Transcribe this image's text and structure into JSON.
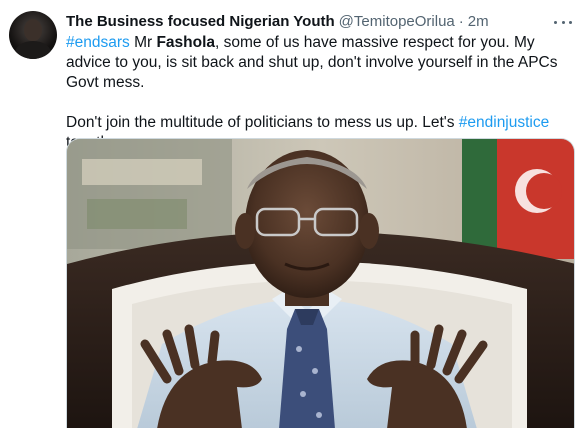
{
  "tweet": {
    "author": {
      "display_name": "The Business focused Nigerian Youth",
      "handle": "@TemitopeOrilua",
      "separator": "·",
      "time": "2m"
    },
    "more_icon": "more-horizontal-icon",
    "paragraph1": {
      "hashtag": "#endsars",
      "text_a": " Mr ",
      "bold": "Fashola",
      "text_b": ", some of us have massive respect for you. My advice to you, is sit back and shut up, don't involve yourself in the APCs Govt mess."
    },
    "paragraph2": {
      "text_a": "Don't join the multitude of politicians to mess us up. Let's ",
      "hashtag": "#endinjustice",
      "text_b": " together."
    }
  },
  "colors": {
    "text": "#0f1419",
    "secondary": "#536471",
    "link": "#1d9bf0",
    "border": "#cfd9de"
  }
}
